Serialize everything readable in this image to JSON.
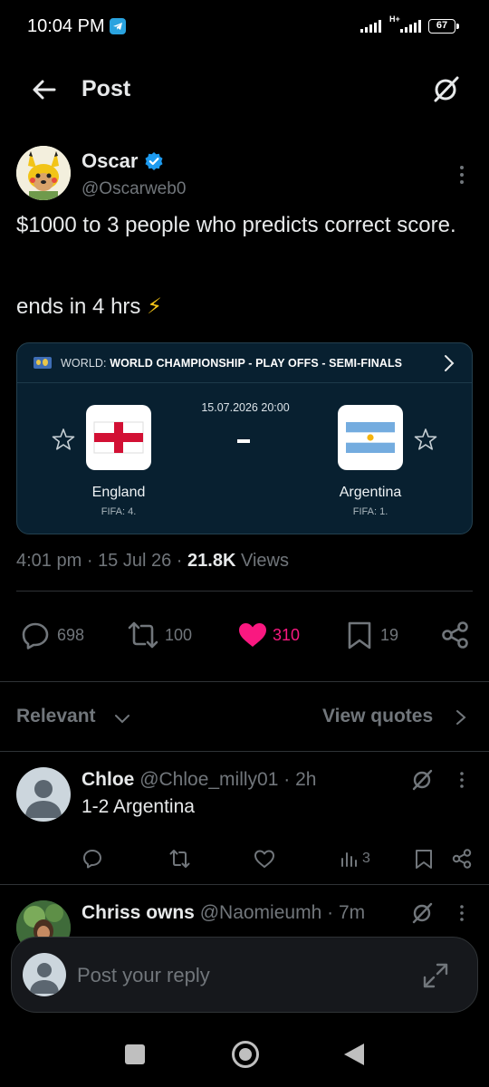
{
  "status_bar": {
    "time": "10:04 PM",
    "network": "H+",
    "battery": "67"
  },
  "header": {
    "title": "Post"
  },
  "post": {
    "author_name": "Oscar",
    "author_handle": "@Oscarweb0",
    "text_line1": "$1000 to 3 people who predicts correct score.",
    "text_line2": "ends in 4 hrs",
    "emoji": "⚡",
    "meta_time": "4:01 pm",
    "meta_sep1": "·",
    "meta_date": "15 Jul 26",
    "meta_sep2": "·",
    "views_count": "21.8K",
    "views_label": "Views"
  },
  "match_card": {
    "league_prefix": "WORLD:",
    "league_name": "WORLD CHAMPIONSHIP - PLAY OFFS - SEMI-FINALS",
    "datetime": "15.07.2026 20:00",
    "home_team": "England",
    "home_fifa": "FIFA: 4.",
    "away_team": "Argentina",
    "away_fifa": "FIFA: 1."
  },
  "actions": {
    "replies": "698",
    "reposts": "100",
    "likes": "310",
    "bookmarks": "19"
  },
  "replies_bar": {
    "sort_label": "Relevant",
    "view_quotes": "View quotes"
  },
  "replies": [
    {
      "name": "Chloe",
      "handle": "@Chloe_milly01",
      "sep": "·",
      "time": "2h",
      "text": "1-2 Argentina",
      "views": "3"
    },
    {
      "name": "Chriss owns",
      "handle": "@Naomieumh",
      "sep": "·",
      "time": "7m"
    }
  ],
  "composer": {
    "placeholder": "Post your reply"
  },
  "colors": {
    "background": "#000000",
    "text_primary": "#e7e9ea",
    "text_secondary": "#71767b",
    "like_pink": "#f91880",
    "verified_blue": "#1d9bf0",
    "card_bg": "#082030"
  }
}
